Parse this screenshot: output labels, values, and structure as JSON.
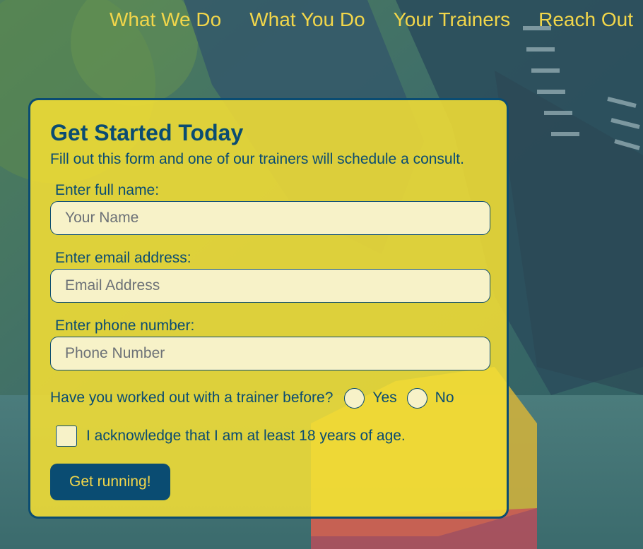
{
  "nav": {
    "items": [
      {
        "label": "What We Do"
      },
      {
        "label": "What You Do"
      },
      {
        "label": "Your Trainers"
      },
      {
        "label": "Reach Out"
      }
    ]
  },
  "form": {
    "title": "Get Started Today",
    "subtitle": "Fill out this form and one of our trainers will schedule a consult.",
    "name_label": "Enter full name:",
    "name_placeholder": "Your Name",
    "email_label": "Enter email address:",
    "email_placeholder": "Email Address",
    "phone_label": "Enter phone number:",
    "phone_placeholder": "Phone Number",
    "trainer_question": "Have you worked out with a trainer before?",
    "yes_label": "Yes",
    "no_label": "No",
    "age_ack_label": "I acknowledge that I am at least 18 years of age.",
    "submit_label": "Get running!"
  },
  "colors": {
    "accent_yellow": "#f2d64a",
    "brand_blue": "#0a4c72",
    "card_yellow": "#f4de34",
    "input_fill": "#f7f2c8"
  }
}
